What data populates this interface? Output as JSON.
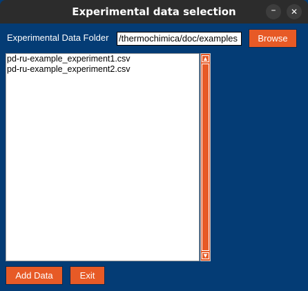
{
  "window": {
    "title": "Experimental data selection",
    "minimize_glyph": "–",
    "close_glyph": "✕"
  },
  "folder": {
    "label": "Experimental Data Folder",
    "value": "/thermochimica/doc/examples"
  },
  "buttons": {
    "browse": "Browse",
    "add_data": "Add Data",
    "exit": "Exit"
  },
  "files": [
    "pd-ru-example_experiment1.csv",
    "pd-ru-example_experiment2.csv"
  ],
  "scrollbar": {
    "up_glyph": "▲",
    "down_glyph": "▼"
  },
  "colors": {
    "background": "#043c75",
    "accent": "#e75a26",
    "titlebar": "#2c2c2c"
  },
  "icons": {
    "minimize": "minimize-icon",
    "close": "close-icon",
    "scroll_up": "scroll-up-arrow-icon",
    "scroll_down": "scroll-down-arrow-icon"
  }
}
